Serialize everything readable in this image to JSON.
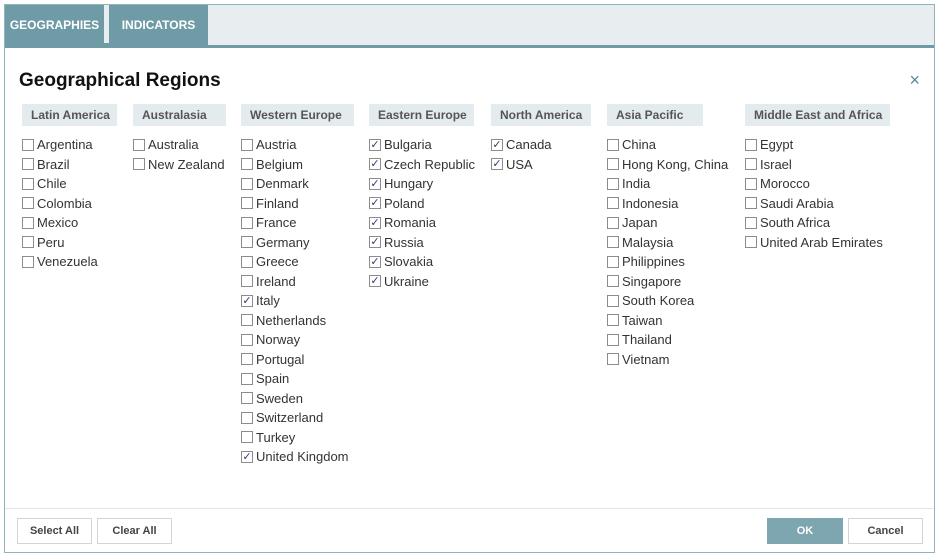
{
  "tabs": {
    "geographies": "GEOGRAPHIES",
    "indicators": "INDICATORS"
  },
  "dialog": {
    "title": "Geographical Regions",
    "close_glyph": "×"
  },
  "colors": {
    "accent": "#6f9ba6",
    "header_bg": "#e4ebee",
    "ok_button": "#7ea6b0",
    "check": "#2c3e6e"
  },
  "regions": [
    {
      "name": "Latin America",
      "items": [
        {
          "label": "Argentina",
          "checked": false
        },
        {
          "label": "Brazil",
          "checked": false
        },
        {
          "label": "Chile",
          "checked": false
        },
        {
          "label": "Colombia",
          "checked": false
        },
        {
          "label": "Mexico",
          "checked": false
        },
        {
          "label": "Peru",
          "checked": false
        },
        {
          "label": "Venezuela",
          "checked": false
        }
      ]
    },
    {
      "name": "Australasia",
      "items": [
        {
          "label": "Australia",
          "checked": false
        },
        {
          "label": "New Zealand",
          "checked": false
        }
      ]
    },
    {
      "name": "Western Europe",
      "items": [
        {
          "label": "Austria",
          "checked": false
        },
        {
          "label": "Belgium",
          "checked": false
        },
        {
          "label": "Denmark",
          "checked": false
        },
        {
          "label": "Finland",
          "checked": false
        },
        {
          "label": "France",
          "checked": false
        },
        {
          "label": "Germany",
          "checked": false
        },
        {
          "label": "Greece",
          "checked": false
        },
        {
          "label": "Ireland",
          "checked": false
        },
        {
          "label": "Italy",
          "checked": true
        },
        {
          "label": "Netherlands",
          "checked": false
        },
        {
          "label": "Norway",
          "checked": false
        },
        {
          "label": "Portugal",
          "checked": false
        },
        {
          "label": "Spain",
          "checked": false
        },
        {
          "label": "Sweden",
          "checked": false
        },
        {
          "label": "Switzerland",
          "checked": false
        },
        {
          "label": "Turkey",
          "checked": false
        },
        {
          "label": "United Kingdom",
          "checked": true
        }
      ]
    },
    {
      "name": "Eastern Europe",
      "items": [
        {
          "label": "Bulgaria",
          "checked": true
        },
        {
          "label": "Czech Republic",
          "checked": true
        },
        {
          "label": "Hungary",
          "checked": true
        },
        {
          "label": "Poland",
          "checked": true
        },
        {
          "label": "Romania",
          "checked": true
        },
        {
          "label": "Russia",
          "checked": true
        },
        {
          "label": "Slovakia",
          "checked": true
        },
        {
          "label": "Ukraine",
          "checked": true
        }
      ]
    },
    {
      "name": "North America",
      "items": [
        {
          "label": "Canada",
          "checked": true
        },
        {
          "label": "USA",
          "checked": true
        }
      ]
    },
    {
      "name": "Asia Pacific",
      "items": [
        {
          "label": "China",
          "checked": false
        },
        {
          "label": "Hong Kong, China",
          "checked": false
        },
        {
          "label": "India",
          "checked": false
        },
        {
          "label": "Indonesia",
          "checked": false
        },
        {
          "label": "Japan",
          "checked": false
        },
        {
          "label": "Malaysia",
          "checked": false
        },
        {
          "label": "Philippines",
          "checked": false
        },
        {
          "label": "Singapore",
          "checked": false
        },
        {
          "label": "South Korea",
          "checked": false
        },
        {
          "label": "Taiwan",
          "checked": false
        },
        {
          "label": "Thailand",
          "checked": false
        },
        {
          "label": "Vietnam",
          "checked": false
        }
      ]
    },
    {
      "name": "Middle East and Africa",
      "items": [
        {
          "label": "Egypt",
          "checked": false
        },
        {
          "label": "Israel",
          "checked": false
        },
        {
          "label": "Morocco",
          "checked": false
        },
        {
          "label": "Saudi Arabia",
          "checked": false
        },
        {
          "label": "South Africa",
          "checked": false
        },
        {
          "label": "United Arab Emirates",
          "checked": false
        }
      ]
    }
  ],
  "footer": {
    "select_all": "Select All",
    "clear_all": "Clear All",
    "ok": "OK",
    "cancel": "Cancel"
  }
}
